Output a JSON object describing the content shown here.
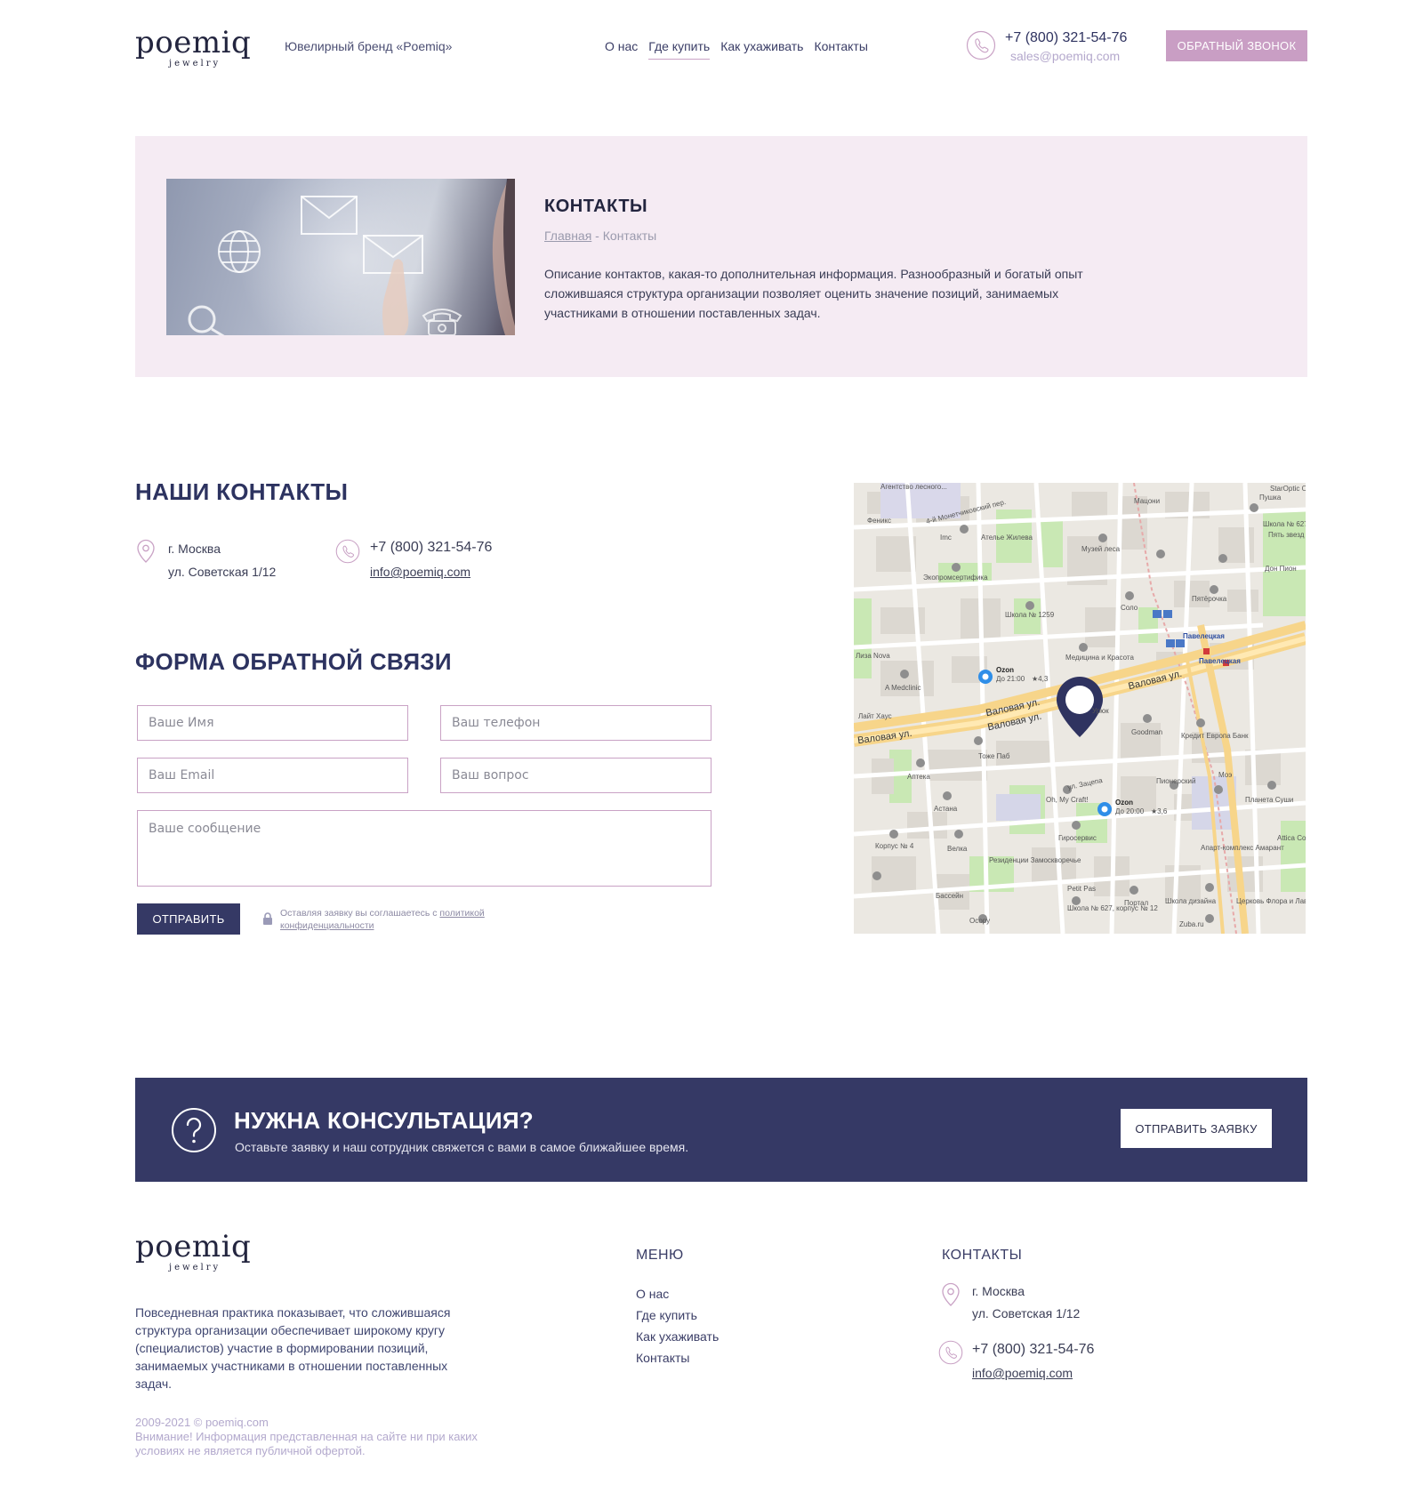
{
  "header": {
    "logo_word": "poemiq",
    "logo_sub": "jewelry",
    "tagline": "Ювелирный бренд «Poemiq»",
    "nav": [
      {
        "label": "О нас"
      },
      {
        "label": "Где купить",
        "active": true
      },
      {
        "label": "Как ухаживать"
      },
      {
        "label": "Контакты"
      }
    ],
    "phone": "+7 (800) 321-54-76",
    "email": "sales@poemiq.com",
    "callback_label": "ОБРАТНЫЙ ЗВОНОК"
  },
  "hero": {
    "title": "КОНТАКТЫ",
    "breadcrumb_home": "Главная",
    "breadcrumb_sep": " - ",
    "breadcrumb_current": "Контакты",
    "description": "Описание контактов, какая-то дополнительная информация. Разнообразный и богатый опыт сложившаяся структура организации позволяет оценить значение позиций, занимаемых участниками в отношении поставленных задач."
  },
  "contacts": {
    "title": "НАШИ КОНТАКТЫ",
    "city": "г. Москва",
    "street": "ул. Советская 1/12",
    "phone": "+7 (800) 321-54-76",
    "email": "info@poemiq.com"
  },
  "form": {
    "title": "ФОРМА ОБРАТНОЙ СВЯЗИ",
    "name_placeholder": "Ваше Имя",
    "phone_placeholder": "Ваш телефон",
    "email_placeholder": "Ваш Email",
    "question_placeholder": "Ваш вопрос",
    "message_placeholder": "Ваше сообщение",
    "submit_label": "ОТПРАВИТЬ",
    "privacy_text": "Оставляя заявку вы соглашаетесь с ",
    "privacy_link": "политикой конфиденциальности"
  },
  "map": {
    "roads": [
      "Валовая ул.",
      "Валовая ул.",
      "Валовая ул.",
      "Валовая ул."
    ],
    "stations": [
      "Павелецкая",
      "Павелецкая"
    ],
    "places": [
      {
        "name": "Ozon",
        "hours": "До 21:00",
        "rating": "★4,3"
      },
      {
        "name": "Ozon",
        "hours": "До 20:00",
        "rating": "★3,6"
      }
    ],
    "labels": [
      "Агентство лесного...",
      "4-й Монетчиковский пер.",
      "Феникс",
      "Imc",
      "Ателье Жилева",
      "Музей леса",
      "StarOptic Оптика",
      "Пушка",
      "Школа № 627",
      "Пять звезд",
      "Дон Пион",
      "Пятёрочка",
      "Солo",
      "Экопромсертифика",
      "Школа № 1259",
      "Медицина и Красота",
      "A Medclinic",
      "Лайт Хаус",
      "Goodman",
      "Кредит Европа Банк",
      "Тоже Паб",
      "Аптека",
      "Oh, My Craft!",
      "Пионерский",
      "Астана",
      "Гиросервис",
      "Корпус № 4",
      "Велка",
      "Резиденции Замоскворечье",
      "Апарт-комплекс Амарант",
      "Petit Pas",
      "Бассейн",
      "Портал",
      "Школа дизайна",
      "Школа № 627, корпус № 12",
      "Осору",
      "Zuba.ru",
      "Церковь Флора и Лавра",
      "Планета Суши",
      "Attica Com",
      "ул. Зацепа",
      "Урюк",
      "Лиза Nova",
      "Моэ",
      "Мацони"
    ]
  },
  "consult": {
    "title": "НУЖНА КОНСУЛЬТАЦИЯ?",
    "subtitle": "Оставьте заявку и наш сотрудник свяжется с вами в самое ближайшее время.",
    "button_label": "ОТПРАВИТЬ ЗАЯВКУ"
  },
  "footer": {
    "logo_word": "poemiq",
    "logo_sub": "jewelry",
    "about": "Повседневная практика показывает, что сложившаяся структура организации обеспечивает широкому кругу (специалистов) участие в формировании позиций, занимаемых участниками в отношении поставленных задач.",
    "copyright": "2009-2021 © poemiq.com",
    "disclaimer": "Внимание! Информация представленная на сайте ни при каких условиях не является публичной офертой.",
    "menu_title": "МЕНЮ",
    "menu": [
      {
        "label": "О нас"
      },
      {
        "label": "Где купить"
      },
      {
        "label": "Как ухаживать"
      },
      {
        "label": "Контакты"
      }
    ],
    "contacts_title": "КОНТАКТЫ",
    "city": "г. Москва",
    "street": "ул. Советская 1/12",
    "phone": "+7 (800) 321-54-76",
    "email": "info@poemiq.com"
  },
  "colors": {
    "accent_pink": "#c99ec4",
    "navy": "#353965",
    "hero_bg": "#f5ebf3",
    "field_border": "#c9a2c5"
  }
}
